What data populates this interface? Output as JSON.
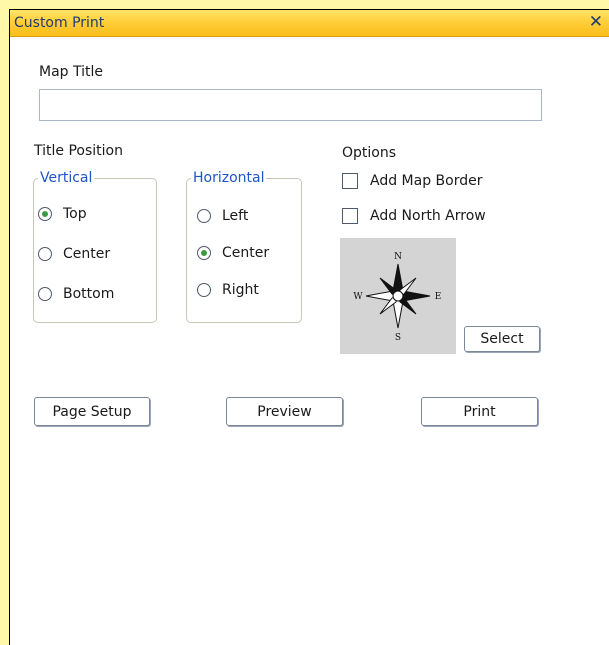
{
  "window": {
    "title": "Custom Print",
    "close_glyph": "✕"
  },
  "map_title": {
    "label": "Map Title",
    "value": "",
    "placeholder": ""
  },
  "title_position": {
    "label": "Title Position",
    "vertical": {
      "legend": "Vertical",
      "options": [
        "Top",
        "Center",
        "Bottom"
      ],
      "selected": "Top"
    },
    "horizontal": {
      "legend": "Horizontal",
      "options": [
        "Left",
        "Center",
        "Right"
      ],
      "selected": "Center"
    }
  },
  "options": {
    "label": "Options",
    "add_map_border": {
      "label": "Add Map Border",
      "checked": false
    },
    "add_north_arrow": {
      "label": "Add North Arrow",
      "checked": false
    },
    "north_arrow_preview": {
      "icon": "compass-rose-icon",
      "letters": {
        "n": "N",
        "s": "S",
        "w": "W",
        "e": "E"
      }
    },
    "select_label": "Select"
  },
  "buttons": {
    "page_setup": "Page Setup",
    "preview": "Preview",
    "print": "Print"
  },
  "colors": {
    "titlebar": "#FFD24A",
    "title_text": "#1F3C6E",
    "legend_text": "#1E54C6",
    "radio_selected": "#3C9A3E",
    "background": "#FFF8A8"
  }
}
